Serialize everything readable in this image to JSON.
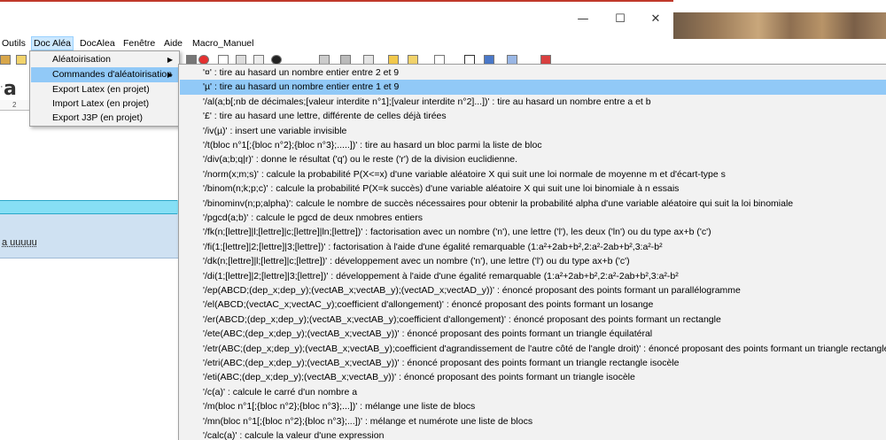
{
  "window": {
    "minimize_glyph": "—",
    "maximize_glyph": "☐",
    "close_glyph": "✕"
  },
  "menubar": {
    "items": [
      {
        "label": "Outils"
      },
      {
        "label": "Doc Aléa"
      },
      {
        "label": "DocAlea"
      },
      {
        "label": "Fenêtre"
      },
      {
        "label": "Aide"
      },
      {
        "label": "Macro_Manuel"
      }
    ],
    "active": "Doc Aléa"
  },
  "editor": {
    "font_glyph": "a",
    "ruler_tick": "2",
    "panel_text": "a uuuuu"
  },
  "dropdown": {
    "items": [
      {
        "label": "Aléatoirisation",
        "has_submenu": true
      },
      {
        "label": "Commandes d'aléatoirisation",
        "has_submenu": true,
        "highlighted": true
      },
      {
        "label": "Export Latex (en projet)",
        "has_submenu": false
      },
      {
        "label": "Import Latex (en projet)",
        "has_submenu": false
      },
      {
        "label": "Export J3P (en projet)",
        "has_submenu": false
      }
    ],
    "submenu_arrow": "▶"
  },
  "submenu": {
    "highlighted_index": 1,
    "items": [
      "'¤' : tire au hasard un nombre entier entre 2 et 9",
      "'µ' : tire au hasard un nombre entier entre 1 et 9",
      "'/al(a;b[;nb de décimales;[valeur interdite n°1];[valeur interdite n°2]...])' : tire au hasard un nombre entre a et b",
      "'£' : tire au hasard une lettre, différente de celles déjà tirées",
      "'/iv(µ)' : insert une variable invisible",
      "'/t(bloc n°1[;{bloc n°2};{bloc n°3};.....])' : tire au hasard un bloc parmi la liste de bloc",
      "'/div(a;b;q|r)' : donne le résultat ('q') ou le reste ('r') de la division euclidienne.",
      "'/norm(x;m;s)' : calcule la probabilité P(X<=x) d'une variable aléatoire X qui suit une loi normale de moyenne m et d'écart-type s",
      "'/binom(n;k;p;c)' : calcule la probabilité P(X=k succès) d'une variable aléatoire X qui suit une loi binomiale à n essais",
      "'/binominv(n;p;alpha)': calcule le nombre de succès nécessaires pour obtenir la probabilité alpha d'une variable aléatoire qui suit la loi binomiale",
      "'/pgcd(a;b)' : calcule le pgcd de deux nmobres entiers",
      "'/fk(n;[lettre]|l;[lettre]|c;[lettre]|ln;[lettre])' : factorisation avec un nombre ('n'), une lettre ('l'), les deux ('ln') ou du type ax+b ('c')",
      "'/fi(1;[lettre]|2;[lettre]|3;[lettre])' : factorisation à l'aide d'une égalité remarquable (1:a²+2ab+b²,2:a²-2ab+b²,3:a²-b²",
      "'/dk(n;[lettre]|l;[lettre]|c;[lettre])' : développement avec un nombre ('n'), une lettre ('l') ou du type ax+b ('c')",
      "'/di(1;[lettre]|2;[lettre]|3;[lettre])' : développement à l'aide d'une égalité remarquable (1:a²+2ab+b²,2:a²-2ab+b²,3:a²-b²",
      "'/ep(ABCD;(dep_x;dep_y);(vectAB_x;vectAB_y);(vectAD_x;vectAD_y))' : énoncé proposant des points formant un parallélogramme",
      "'/el(ABCD;(vectAC_x;vectAC_y);coefficient d'allongement)' : énoncé proposant des points formant un losange",
      "'/er(ABCD;(dep_x;dep_y);(vectAB_x;vectAB_y);coefficient d'allongement)' : énoncé proposant des points formant un rectangle",
      "'/ete(ABC;(dep_x;dep_y);(vectAB_x;vectAB_y))' : énoncé proposant des points formant un triangle équilatéral",
      "'/etr(ABC;(dep_x;dep_y);(vectAB_x;vectAB_y);coefficient d'agrandissement de l'autre côté de l'angle droit)' : énoncé proposant des points formant un triangle rectangle",
      "'/etri(ABC;(dep_x;dep_y);(vectAB_x;vectAB_y))' : énoncé proposant des points formant un triangle rectangle isocèle",
      "'/eti(ABC;(dep_x;dep_y);(vectAB_x;vectAB_y))' : énoncé proposant des points formant un triangle isocèle",
      "'/c(a)' : calcule le carré d'un nombre a",
      "'/m(bloc n°1[;{bloc n°2};{bloc n°3};...])' : mélange une liste de blocs",
      "'/mn(bloc n°1[;{bloc n°2};{bloc n°3};...])' : mélange et numérote une liste de blocs",
      "'/calc(a)' : calcule la valeur d'une expression"
    ]
  }
}
